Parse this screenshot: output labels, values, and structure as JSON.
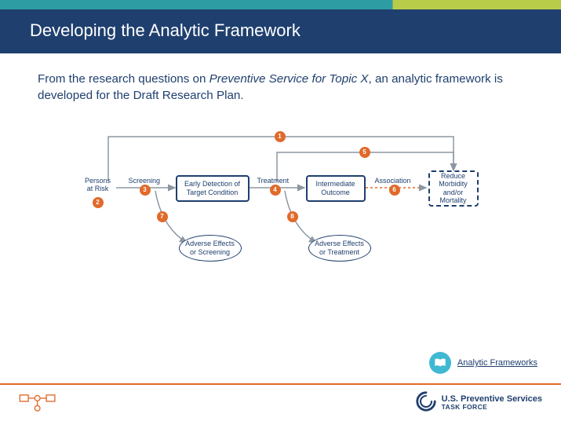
{
  "title": "Developing the Analytic Framework",
  "body_prefix": "From the research questions on ",
  "body_em": "Preventive Service for Topic X",
  "body_suffix": ", an analytic framework is developed for the Draft Research Plan.",
  "nodes": {
    "persons": "Persons\nat Risk",
    "screening": "Screening",
    "detection": "Early Detection of\nTarget Condition",
    "treatment": "Treatment",
    "intermediate": "Intermediate\nOutcome",
    "association": "Association",
    "reduce": "Reduce\nMorbidity\nand/or\nMortality",
    "adverse_screen": "Adverse Effects\nor Screening",
    "adverse_treat": "Adverse Effects\nor Treatment"
  },
  "kq": {
    "1": "1",
    "2": "2",
    "3": "3",
    "4": "4",
    "5": "5",
    "6": "6",
    "7": "7",
    "8": "8"
  },
  "resource_link": "Analytic Frameworks",
  "brand": {
    "line1": "U.S. Preventive Services",
    "line2": "TASK FORCE"
  }
}
